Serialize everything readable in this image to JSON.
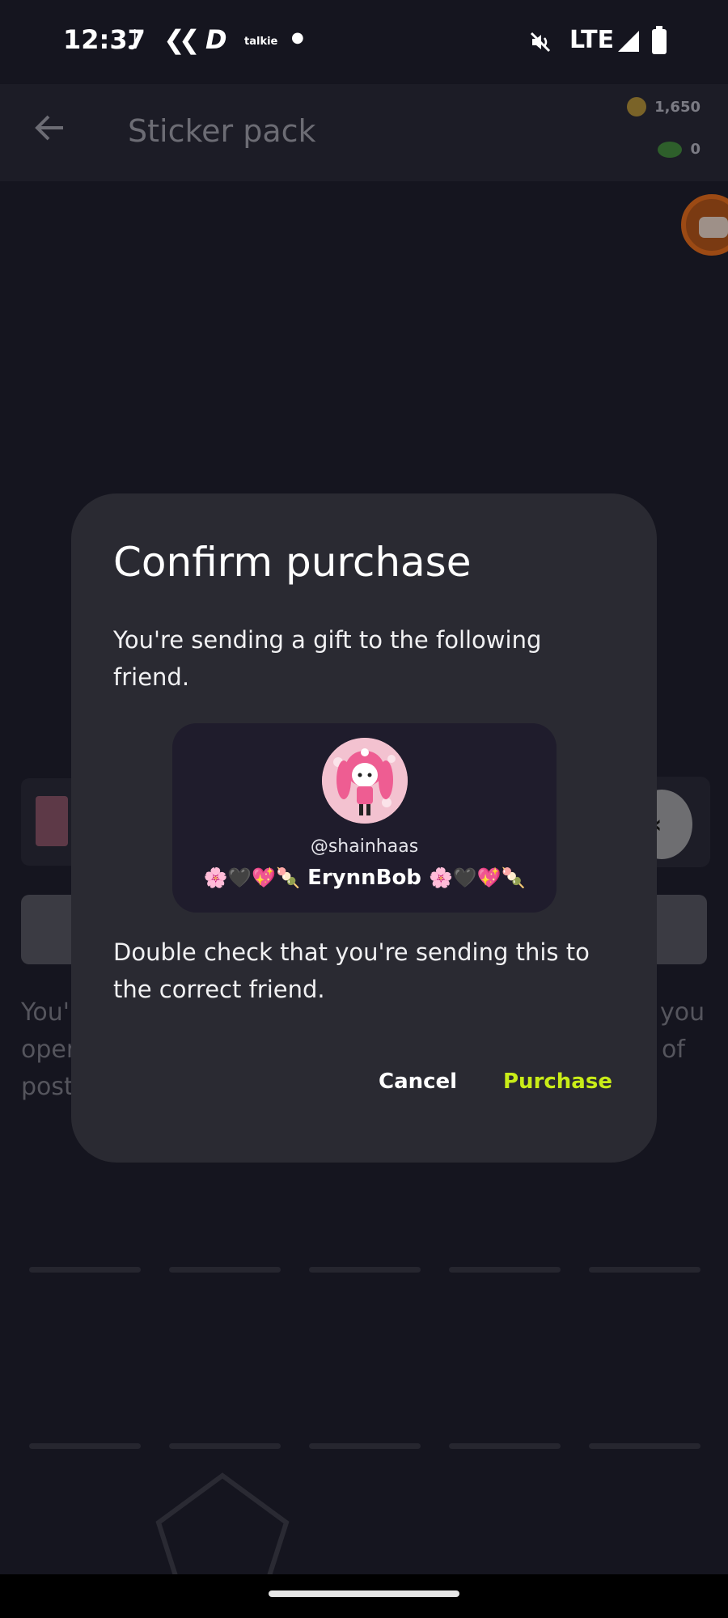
{
  "status_bar": {
    "time": "12:37",
    "notification_icons": [
      "tiktok-icon",
      "kik-icon",
      "d-app-icon",
      "talkie-icon",
      "dot-icon"
    ],
    "talkie_label": "talkie",
    "network": "LTE",
    "right_icons": [
      "mute-icon",
      "signal-icon",
      "battery-icon"
    ]
  },
  "app_bar": {
    "title": "Sticker pack",
    "coins": "1,650",
    "gems": "0"
  },
  "background": {
    "text_left": [
      "You'",
      "oper",
      "post"
    ],
    "text_right": [
      "you",
      "of"
    ]
  },
  "dialog": {
    "title": "Confirm purchase",
    "message": "You're sending a gift to the following friend.",
    "friend": {
      "handle": "@shainhaas",
      "display_name": "ErynnBob",
      "decoration_left": "🌸🖤💖🍡",
      "decoration_right": "🌸🖤💖🍡"
    },
    "warning": "Double check that you're sending this to the correct friend.",
    "cancel_label": "Cancel",
    "purchase_label": "Purchase"
  },
  "colors": {
    "background": "#15151f",
    "dialog": "#2a2a32",
    "accent": "#c9ec18",
    "friend_card": "#1f1c2c"
  }
}
